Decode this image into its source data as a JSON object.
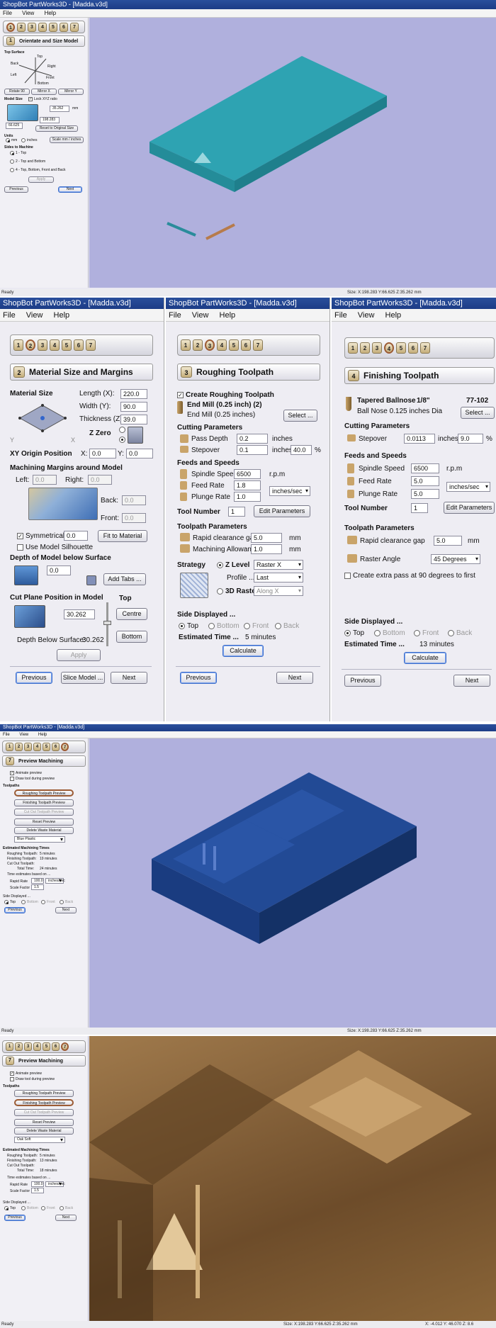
{
  "p1": {
    "title": "ShopBot PartWorks3D - [Madda.v3d]",
    "menu": [
      "File",
      "View",
      "Help"
    ],
    "header": "Orientate and Size Model",
    "header_num": "1",
    "steps": [
      "1",
      "2",
      "3",
      "4",
      "5",
      "6",
      "7"
    ],
    "top_surface": "Top Surface",
    "dirs": {
      "top": "Top",
      "back": "Back",
      "right": "Right",
      "left": "Left",
      "front": "Front",
      "bottom": "Bottom"
    },
    "rotate_btn": "Rotate 90",
    "mirror_btn1": "Mirror X",
    "mirror_btn2": "Mirror Y",
    "model_size": "Model Size",
    "lock_xyz": "Lock XYZ ratio",
    "size_z": "35.262",
    "size_y": "198.283",
    "size_x": "66.625",
    "unit_mm": "mm",
    "reset_btn": "Reset to Original Size",
    "units": "Units",
    "units_mm": "mm",
    "units_inches": "inches",
    "scale_btn": "Scale mm / inches",
    "sides": "Sides to Machine",
    "side1": "1 - Top",
    "side2": "2 - Top and Bottom",
    "side3": "4 - Top, Bottom, Front and Back",
    "apply": "Apply",
    "previous": "Previous",
    "next": "Next",
    "status_left": "Ready",
    "status_right": "Size: X:198.283 Y:66.625 Z:35.262 mm"
  },
  "p2": {
    "title": "ShopBot PartWorks3D - [Madda.v3d]",
    "menu": [
      "File",
      "View",
      "Help"
    ],
    "header_num": "2",
    "header": "Material Size and Margins",
    "material_size": "Material Size",
    "length_label": "Length (X):",
    "length": "220.0",
    "width_label": "Width (Y):",
    "width": "90.0",
    "thickness_label": "Thickness (Z):",
    "thickness": "39.0",
    "z_zero": "Z Zero",
    "axis_x": "X",
    "axis_y": "Y",
    "xy_origin": "XY Origin Position",
    "x_label": "X:",
    "x_val": "0.0",
    "y_label": "Y:",
    "y_val": "0.0",
    "margins": "Machining Margins around Model",
    "left": "Left:",
    "left_val": "0.0",
    "right": "Right:",
    "right_val": "0.0",
    "back": "Back:",
    "back_val": "0.0",
    "front": "Front:",
    "front_val": "0.0",
    "symmetrical": "Symmetrical",
    "sym_val": "0.0",
    "fit_btn": "Fit to Material",
    "silhouette": "Use Model Silhouette",
    "depth_title": "Depth of Model below Surface",
    "depth_val": "0.0",
    "add_tabs": "Add Tabs ...",
    "cut_plane": "Cut Plane Position in Model",
    "top_label": "Top",
    "cut_val": "30.262",
    "centre_btn": "Centre",
    "bottom_btn": "Bottom",
    "depth_below": "Depth Below Surface:",
    "depth_below_val": "30.262",
    "apply": "Apply",
    "previous": "Previous",
    "slice": "Slice Model ...",
    "next": "Next"
  },
  "p3": {
    "title": "ShopBot PartWorks3D - [Madda.v3d]",
    "menu": [
      "File",
      "View",
      "Help"
    ],
    "header_num": "3",
    "header": "Roughing Toolpath",
    "create": "Create Roughing Toolpath",
    "tool_name": "End Mill (0.25 inch) (2)",
    "tool_desc": "End Mill (0.25 inches)",
    "select_btn": "Select ...",
    "cutting": "Cutting Parameters",
    "pass_depth": "Pass Depth",
    "pass_val": "0.2",
    "stepover": "Stepover",
    "step_val": "0.1",
    "step_pct": "40.0",
    "inches": "inches",
    "pct": "%",
    "feeds": "Feeds and Speeds",
    "spindle": "Spindle Speed",
    "spindle_val": "6500",
    "rpm": "r.p.m",
    "feed": "Feed Rate",
    "feed_val": "1.8",
    "plunge": "Plunge Rate",
    "plunge_val": "1.0",
    "rate_unit": "inches/sec",
    "tool_number": "Tool Number",
    "tool_num_val": "1",
    "edit_btn": "Edit Parameters",
    "tp_params": "Toolpath Parameters",
    "rapid": "Rapid clearance gap",
    "rapid_val": "5.0",
    "allowance": "Machining Allowance",
    "allow_val": "1.0",
    "mm": "mm",
    "strategy": "Strategy",
    "zlevel": "Z Level",
    "raster_x": "Raster X",
    "profile": "Profile ...",
    "last": "Last",
    "raster3d": "3D Raster",
    "along_x": "Along X",
    "side_disp": "Side Displayed ...",
    "s_top": "Top",
    "s_bottom": "Bottom",
    "s_front": "Front",
    "s_back": "Back",
    "est": "Estimated Time ...",
    "est_val": "5 minutes",
    "calc": "Calculate",
    "previous": "Previous",
    "next": "Next"
  },
  "p4": {
    "title": "ShopBot PartWorks3D - [Madda.v3d]",
    "menu": [
      "File",
      "View",
      "Help"
    ],
    "header_num": "4",
    "header": "Finishing Toolpath",
    "tool_name": "Tapered Ballnose",
    "tool_size": "1/8\"",
    "tool_code": "77-102",
    "tool_desc": "Ball Nose 0.125 inches Dia",
    "select_btn": "Select ...",
    "cutting": "Cutting Parameters",
    "stepover": "Stepover",
    "step_val": "0.0113",
    "inches": "inches",
    "step_pct": "9.0",
    "pct": "%",
    "feeds": "Feeds and Speeds",
    "spindle": "Spindle Speed",
    "spindle_val": "6500",
    "rpm": "r.p.m",
    "feed": "Feed Rate",
    "feed_val": "5.0",
    "plunge": "Plunge Rate",
    "plunge_val": "5.0",
    "rate_unit": "inches/sec",
    "tool_number": "Tool Number",
    "tool_num_val": "1",
    "edit_btn": "Edit Parameters",
    "tp_params": "Toolpath Parameters",
    "rapid": "Rapid clearance gap",
    "rapid_val": "5.0",
    "mm": "mm",
    "raster_angle": "Raster Angle",
    "angle_val": "45 Degrees",
    "extra_pass": "Create extra pass at 90 degrees to first",
    "side_disp": "Side Displayed ...",
    "s_top": "Top",
    "s_bottom": "Bottom",
    "s_front": "Front",
    "s_back": "Back",
    "est": "Estimated Time ...",
    "est_val": "13 minutes",
    "calc": "Calculate",
    "previous": "Previous",
    "next": "Next"
  },
  "p5": {
    "title": "ShopBot PartWorks3D - [Madda.v3d]",
    "menu": [
      "File",
      "View",
      "Help"
    ],
    "header_num": "7",
    "header": "Preview Machining",
    "animate": "Animate preview",
    "draw_tool": "Draw tool during preview",
    "toolpaths": "Toolpaths",
    "rough_prev": "Roughing Toolpath Preview",
    "finish_prev": "Finishing Toolpath Preview",
    "cutout_prev": "Cut Out Toolpath Preview",
    "reset_prev": "Reset Preview",
    "delete_mat": "Delete Waste Material",
    "material": "Blue Plastic",
    "est_title": "Estimated Machining Times",
    "rough_t": "Roughing Toolpath:",
    "rough_v": "5 minutes",
    "finish_t": "Finishing Toolpath:",
    "finish_v": "19 minutes",
    "cutout_t": "Cut Out Toolpath:",
    "cutout_v": "",
    "total_t": "Total Time:",
    "total_v": "24 minutes",
    "based": "Time estimates based on ...",
    "rapid_rate": "Rapid Rate",
    "rapid_val": "100.0",
    "rate_unit": "inches/sec",
    "scale_factor": "Scale Factor",
    "scale_val": "1.5",
    "side_disp": "Side Displayed ...",
    "s_top": "Top",
    "s_bottom": "Bottom",
    "s_front": "Front",
    "s_back": "Back",
    "previous": "Previous",
    "next": "Next",
    "status_left": "Ready",
    "status_right": "Size: X:198.283 Y:66.625 Z:35.262 mm"
  },
  "p6": {
    "header_num": "7",
    "header": "Preview Machining",
    "animate": "Animate preview",
    "draw_tool": "Draw tool during preview",
    "toolpaths": "Toolpaths",
    "rough_prev": "Roughing Toolpath Preview",
    "finish_prev": "Finishing Toolpath Preview",
    "cutout_prev": "Cut Out Toolpath Preview",
    "reset_prev": "Reset Preview",
    "delete_mat": "Delete Waste Material",
    "material": "Oak Soft",
    "est_title": "Estimated Machining Times",
    "rough_t": "Roughing Toolpath:",
    "rough_v": "5 minutes",
    "finish_t": "Finishing Toolpath:",
    "finish_v": "13 minutes",
    "cutout_t": "Cut Out Toolpath:",
    "cutout_v": "",
    "total_t": "Total Time:",
    "total_v": "18 minutes",
    "based": "Time estimates based on ...",
    "rapid_rate": "Rapid Rate",
    "rapid_val": "100.0",
    "rate_unit": "inches/sec",
    "scale_factor": "Scale Factor",
    "scale_val": "1.5",
    "side_disp": "Side Displayed ...",
    "s_top": "Top",
    "s_bottom": "Bottom",
    "s_front": "Front",
    "s_back": "Back",
    "previous": "Previous",
    "next": "Next",
    "status_left": "Ready",
    "status_right": "Size: X:198.283 Y:66.625 Z:35.262 mm",
    "status_right2": "X: -4.012 Y: 46.070 Z: 8.6"
  }
}
